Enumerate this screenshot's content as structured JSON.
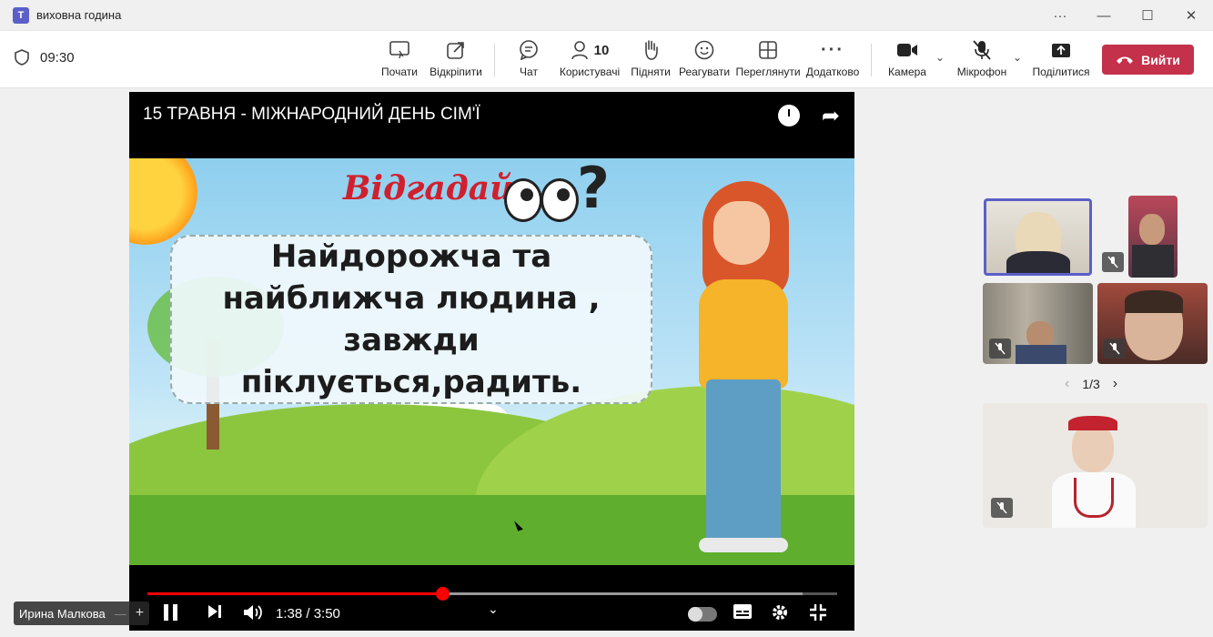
{
  "window": {
    "title": "виховна година",
    "app_icon": "teams-icon",
    "controls": [
      "more-icon",
      "minimize-icon",
      "maximize-icon",
      "close-icon"
    ]
  },
  "meeting": {
    "timer": "09:30",
    "participant_count": "10"
  },
  "toolbar": {
    "buttons": [
      {
        "label": "Почати",
        "icon": "share-screen-icon"
      },
      {
        "label": "Відкріпити",
        "icon": "popout-icon"
      },
      {
        "label": "Чат",
        "icon": "chat-icon"
      },
      {
        "label": "Користувачі",
        "icon": "people-icon"
      },
      {
        "label": "Підняти",
        "icon": "raise-hand-icon"
      },
      {
        "label": "Реагувати",
        "icon": "emoji-icon"
      },
      {
        "label": "Переглянути",
        "icon": "view-icon"
      },
      {
        "label": "Додатково",
        "icon": "more-icon"
      },
      {
        "label": "Камера",
        "icon": "camera-icon"
      },
      {
        "label": "Мікрофон",
        "icon": "mic-off-icon"
      },
      {
        "label": "Поділитися",
        "icon": "share-upload-icon"
      }
    ],
    "leave_label": "Вийти",
    "leave_color": "#c4314b"
  },
  "video": {
    "title": "15 ТРАВНЯ - МІЖНАРОДНИЙ ДЕНЬ СІМ'Ї",
    "slide": {
      "heading": "Відгадай",
      "riddle": "Найдорожча та найближча людина , завжди піклується,радить."
    },
    "time_display": "1:38 / 3:50",
    "progress": 0.4278,
    "buffered": 0.95,
    "accent_color": "#ff0000"
  },
  "presenter": {
    "name": "Ирина Малкова"
  },
  "gallery": {
    "pager": "1/3"
  }
}
